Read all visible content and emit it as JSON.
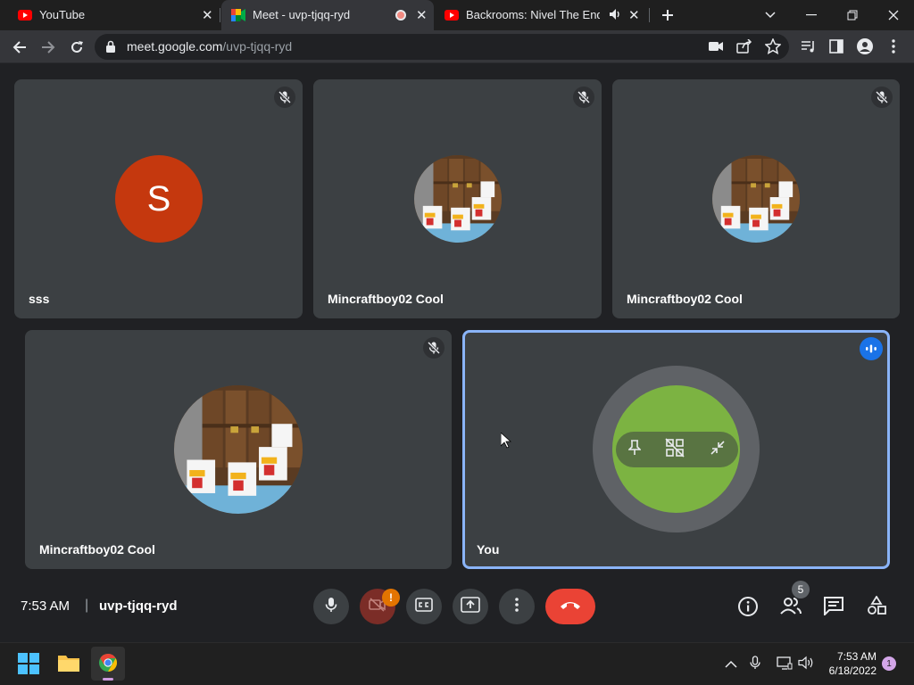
{
  "browser": {
    "tabs": [
      {
        "title": "YouTube",
        "icon": "youtube-icon"
      },
      {
        "title": "Meet - uvp-tjqq-ryd",
        "icon": "google-meet-icon"
      },
      {
        "title": "Backrooms: Nivel The End | E",
        "icon": "youtube-icon"
      }
    ],
    "url_domain": "meet.google.com",
    "url_path": "/uvp-tjqq-ryd"
  },
  "meet": {
    "tiles": [
      {
        "name": "sss",
        "avatar_letter": "S"
      },
      {
        "name": "Mincraftboy02 Cool"
      },
      {
        "name": "Mincraftboy02 Cool"
      },
      {
        "name": "Mincraftboy02 Cool"
      },
      {
        "name": "You"
      }
    ],
    "time": "7:53 AM",
    "divider": "|",
    "meeting_code": "uvp-tjqq-ryd",
    "camera_alert_badge": "!",
    "people_count": "5",
    "colors": {
      "background": "#202124",
      "tile": "#3c4043",
      "end_call": "#ea4335",
      "avatar_s": "#c5380e",
      "self_avatar": "#7cb342",
      "active_border": "#8ab4f8"
    }
  },
  "taskbar": {
    "time": "7:53 AM",
    "date": "6/18/2022",
    "notification_count": "1"
  }
}
